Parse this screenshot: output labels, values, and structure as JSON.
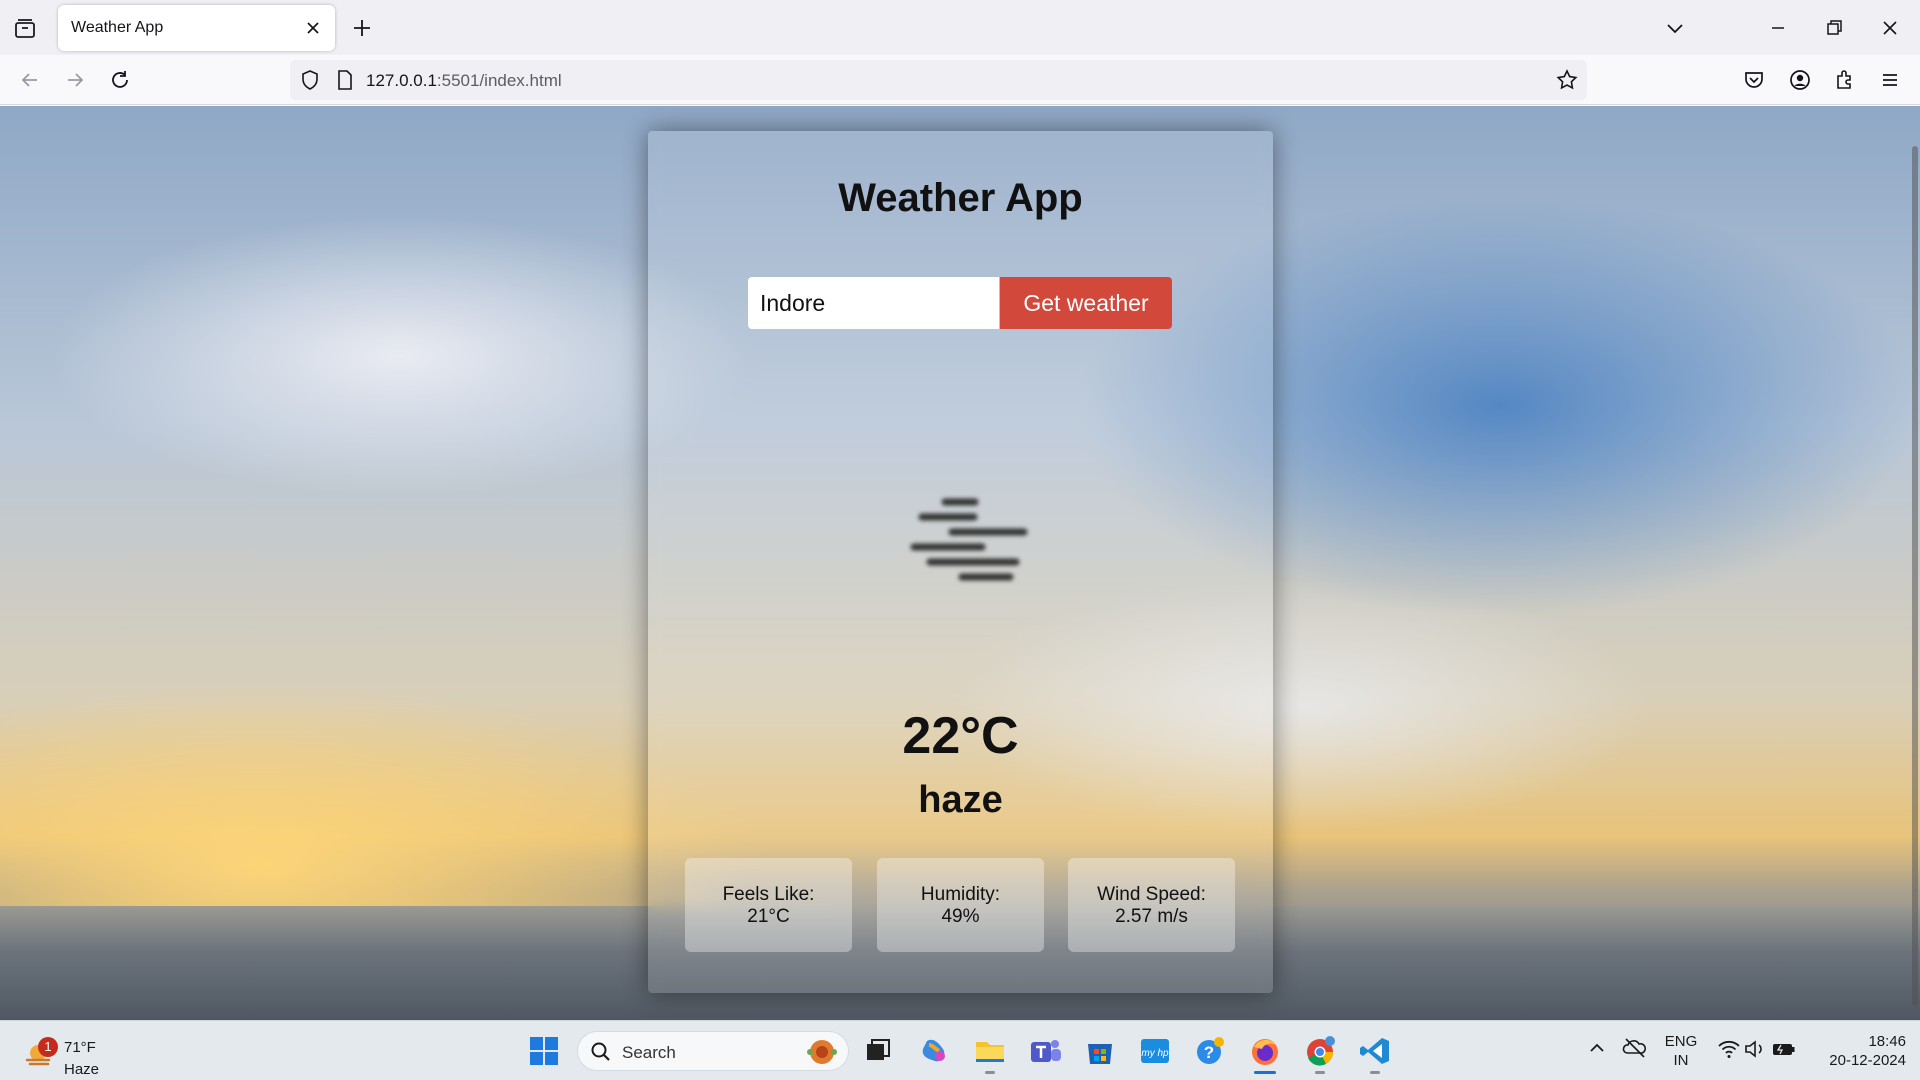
{
  "browser": {
    "tab_title": "Weather App",
    "url_host": "127.0.0.1",
    "url_rest": ":5501/index.html"
  },
  "app": {
    "title": "Weather App",
    "city_value": "Indore",
    "button_label": "Get weather",
    "temperature": "22°C",
    "description": "haze",
    "stats": [
      {
        "label": "Feels Like:",
        "value": "21°C"
      },
      {
        "label": "Humidity:",
        "value": "49%"
      },
      {
        "label": "Wind Speed:",
        "value": "2.57 m/s"
      }
    ]
  },
  "taskbar": {
    "weather_badge": "1",
    "weather_temp": "71°F",
    "weather_cond": "Haze",
    "search_label": "Search",
    "lang_top": "ENG",
    "lang_bottom": "IN",
    "time": "18:46",
    "date": "20-12-2024"
  },
  "colors": {
    "accent_button": "#d2483a",
    "tab_bg": "#f0f0f4"
  }
}
